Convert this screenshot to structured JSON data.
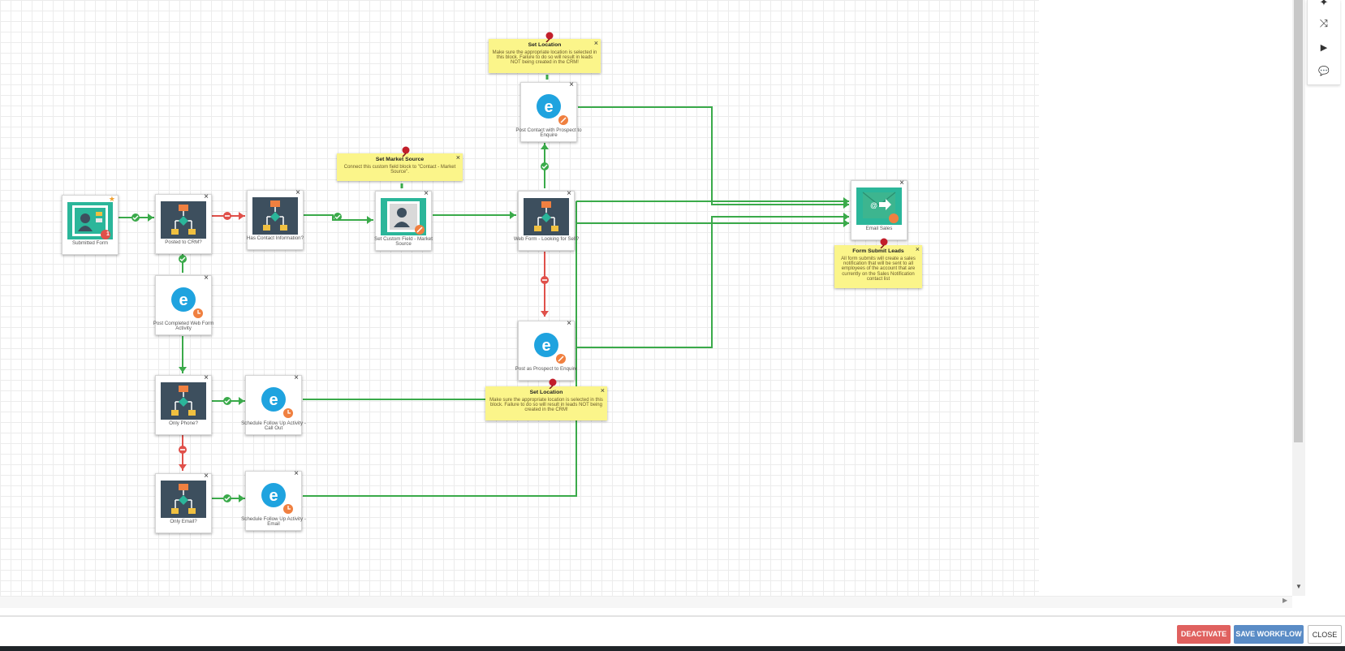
{
  "canvas": {
    "nodes": [
      {
        "id": "submitted-form",
        "label": "Submitted Form",
        "type": "contact-source"
      },
      {
        "id": "posted-to-crm",
        "label": "Posted to CRM?",
        "type": "decision"
      },
      {
        "id": "has-contact-info",
        "label": "Has Contact Information?",
        "type": "decision"
      },
      {
        "id": "set-custom-field",
        "label": "Set Custom Field - Market Source",
        "type": "contact-action"
      },
      {
        "id": "web-form-looking",
        "label": "Web Form - Looking for Sell?",
        "type": "decision"
      },
      {
        "id": "post-contact-prospect",
        "label": "Post Contact with Prospect to Enquire",
        "type": "eloqua-action"
      },
      {
        "id": "post-prospect-enquire",
        "label": "Post as Prospect to Enquire",
        "type": "eloqua-action"
      },
      {
        "id": "post-completed-web",
        "label": "Post Completed Web Form Activity",
        "type": "eloqua-activity"
      },
      {
        "id": "only-phone",
        "label": "Only Phone?",
        "type": "decision"
      },
      {
        "id": "schedule-call",
        "label": "Schedule Follow Up Activity - Call Out",
        "type": "eloqua-activity"
      },
      {
        "id": "only-email",
        "label": "Only Email?",
        "type": "decision"
      },
      {
        "id": "schedule-email",
        "label": "Schedule Follow Up Activity - Email",
        "type": "eloqua-activity"
      },
      {
        "id": "email-sales",
        "label": "Email Sales",
        "type": "email"
      }
    ],
    "notes": [
      {
        "id": "note-set-location-top",
        "title": "Set Location",
        "body": "Make sure the appropriate location is selected in this block. Failure to do so will result in leads NOT being created in the CRM!"
      },
      {
        "id": "note-market-source",
        "title": "Set Market Source",
        "body": "Connect this custom field block to \"Contact - Market Source\"."
      },
      {
        "id": "note-set-location-bottom",
        "title": "Set Location",
        "body": "Make sure the appropriate location is selected in this block. Failure to do so will result in leads NOT being created in the CRM!"
      },
      {
        "id": "note-form-submit-leads",
        "title": "Form Submit Leads",
        "body": "All form submits will create a sales notification that will be sent to all employees of the account that are currently on the Sales Notification contact list"
      }
    ],
    "badge_count": "1",
    "close_glyph": "×"
  },
  "toolpanel": {
    "icons": [
      "pin-icon",
      "shuffle-icon",
      "play-icon",
      "comment-icon"
    ]
  },
  "footer": {
    "deactivate_label": "DEACTIVATE",
    "save_label": "SAVE WORKFLOW",
    "close_label": "CLOSE"
  },
  "colors": {
    "wire_green": "#3aaa4a",
    "wire_red": "#e0504a",
    "note_yellow": "#fbf58a",
    "deactivate": "#e0615f",
    "save": "#5a8cc6"
  }
}
